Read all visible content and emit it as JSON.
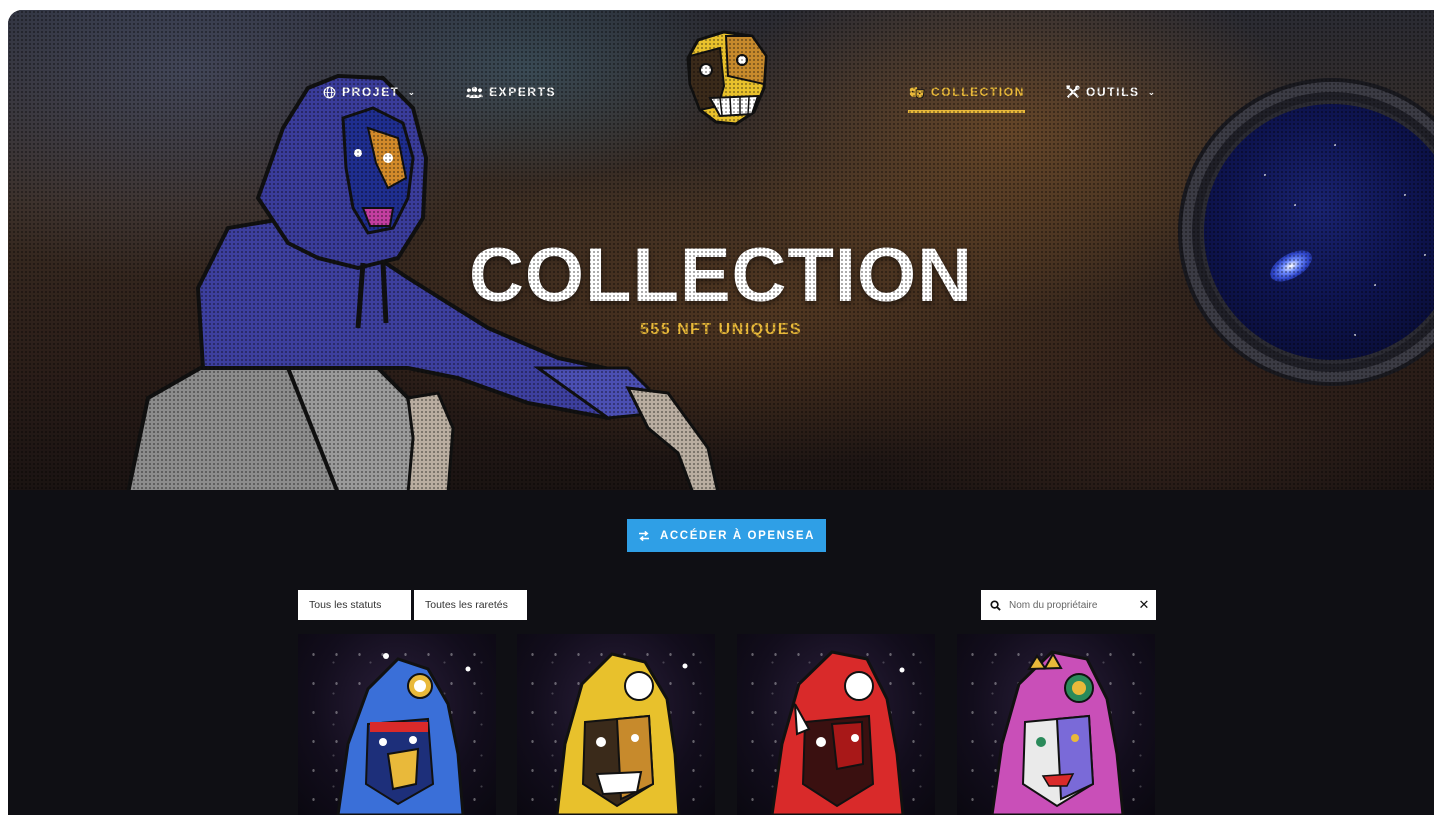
{
  "nav": {
    "projet_label": "PROJET",
    "experts_label": "EXPERTS",
    "collection_label": "COLLECTION",
    "outils_label": "OUTILS"
  },
  "hero": {
    "title": "COLLECTION",
    "subtitle": "555 NFT UNIQUES"
  },
  "cta": {
    "label": "ACCÉDER À OPENSEA"
  },
  "filters": {
    "status_selected": "Tous les statuts",
    "rarity_selected": "Toutes les raretés",
    "search_placeholder": "Nom du propriétaire",
    "search_value": ""
  },
  "cards": [
    {
      "hood_color": "#3a6fd8"
    },
    {
      "hood_color": "#e8c12c"
    },
    {
      "hood_color": "#d92a2a"
    },
    {
      "hood_color": "#c94fb8"
    }
  ],
  "colors": {
    "accent_gold": "#e9b93a",
    "cta_blue": "#2f9fe6",
    "page_dark": "#0f0f14"
  },
  "icons": {
    "projet": "globe-icon",
    "experts": "users-icon",
    "collection": "mask-icon",
    "outils": "tools-icon",
    "cta": "exchange-icon",
    "search": "search-icon",
    "clear": "close-icon"
  }
}
